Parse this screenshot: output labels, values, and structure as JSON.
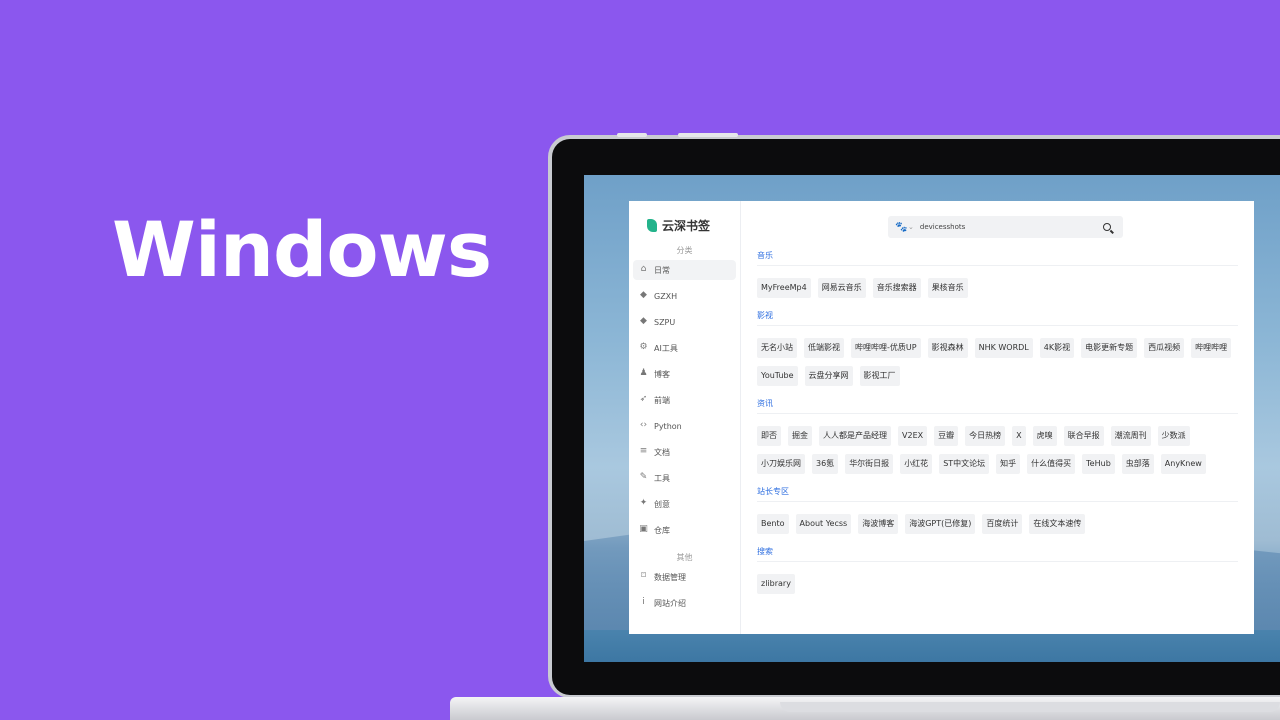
{
  "hero": {
    "title": "Windows"
  },
  "app": {
    "brand": "云深书签",
    "sidebar": {
      "group_category": "分类",
      "items": [
        {
          "label": "日常",
          "icon": "home-icon"
        },
        {
          "label": "GZXH",
          "icon": "graduation-cap-icon"
        },
        {
          "label": "SZPU",
          "icon": "graduation-cap-icon"
        },
        {
          "label": "AI工具",
          "icon": "settings-icon"
        },
        {
          "label": "博客",
          "icon": "users-icon"
        },
        {
          "label": "前端",
          "icon": "rocket-icon"
        },
        {
          "label": "Python",
          "icon": "code-icon"
        },
        {
          "label": "文档",
          "icon": "document-icon"
        },
        {
          "label": "工具",
          "icon": "wrench-icon"
        },
        {
          "label": "创意",
          "icon": "sparkle-icon"
        },
        {
          "label": "仓库",
          "icon": "gift-icon"
        }
      ],
      "group_other": "其他",
      "other_items": [
        {
          "label": "数据管理",
          "icon": "bookmark-icon"
        },
        {
          "label": "网站介绍",
          "icon": "info-icon"
        }
      ]
    },
    "search": {
      "value": "devicesshots",
      "engine_icon": "baidu-paw-icon"
    },
    "sections": [
      {
        "title": "音乐",
        "links": [
          "MyFreeMp4",
          "网易云音乐",
          "音乐搜索器",
          "果核音乐"
        ]
      },
      {
        "title": "影视",
        "links": [
          "无名小站",
          "低端影视",
          "哔哩哔哩-优质UP",
          "影视森林",
          "NHK WORDL",
          "4K影视",
          "电影更新专题",
          "西瓜视频",
          "哔哩哔哩",
          "YouTube",
          "云盘分享网",
          "影视工厂"
        ]
      },
      {
        "title": "资讯",
        "links": [
          "即否",
          "掘金",
          "人人都是产品经理",
          "V2EX",
          "豆瓣",
          "今日热榜",
          "X",
          "虎嗅",
          "联合早报",
          "潮流周刊",
          "少数派",
          "小刀娱乐网",
          "36氪",
          "华尔街日报",
          "小红花",
          "ST中文论坛",
          "知乎",
          "什么值得买",
          "TeHub",
          "虫部落",
          "AnyKnew"
        ]
      },
      {
        "title": "站长专区",
        "links": [
          "Bento",
          "About Yecss",
          "海波博客",
          "海波GPT(已修复)",
          "百度统计",
          "在线文本速传"
        ]
      },
      {
        "title": "搜索",
        "links": [
          "zlibrary"
        ]
      }
    ]
  }
}
